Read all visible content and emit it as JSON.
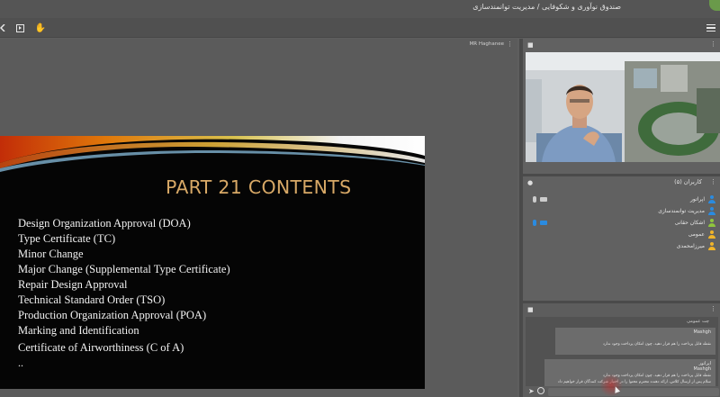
{
  "app": {
    "window_title": "صندوق نوآوری و شکوفایی / مدیریت توانمندسازی",
    "accent_color": "#6a9a4a"
  },
  "toolbar": {
    "icons": [
      "back-arrow-icon",
      "screen-share-icon",
      "hand-icon",
      "menu-icon"
    ],
    "hand_glyph": "✋"
  },
  "presentation": {
    "presenter_name": "MR Haghanee",
    "more_glyph": "⋮",
    "slide": {
      "title": "PART 21 CONTENTS",
      "items": [
        "Design Organization Approval (DOA)",
        "Type Certificate (TC)",
        "Minor Change",
        "Major Change (Supplemental Type Certificate)",
        "Repair Design Approval",
        "Technical Standard Order (TSO)",
        "Production Organization Approval (POA)",
        "Marking and Identification",
        "Certificate of Airworthiness (C of A)"
      ],
      "trailing": "..",
      "title_color": "#d7a866"
    }
  },
  "users": {
    "title": "کاربران (۵)",
    "list": [
      {
        "name": "اپراتور",
        "color": "#2a8be0",
        "mic": true,
        "cam": true,
        "active": false
      },
      {
        "name": "مدیریت توانمندسازی",
        "color": "#2a8be0",
        "mic": false,
        "cam": false,
        "active": false
      },
      {
        "name": "اشکان حقانی",
        "color": "#8fc63e",
        "mic": false,
        "cam": true,
        "active": true
      },
      {
        "name": "عمومی",
        "color": "#f0b429",
        "mic": false,
        "cam": false,
        "active": false
      },
      {
        "name": "میرزامحمدی",
        "color": "#f0b429",
        "mic": false,
        "cam": false,
        "active": false
      }
    ]
  },
  "chat": {
    "from_label": "چت عمومی",
    "messages": [
      {
        "name": "Mashgh",
        "text": "نقطه قابل پرداخت را هم قرار دهید. چون امکان پرداخت وجود ندارد"
      },
      {
        "name": "Mashgh",
        "sender": "اپراتور",
        "text": "نقطه قابل پرداخت را هم قرار دهید. چون امکان پرداخت وجود ندارد",
        "text2": "سلام پس از ارسال کلاس، ارائه دهنده محترم محتوا را در اختیار شرکت کنندگان قرار خواهیم داد"
      }
    ],
    "input_placeholder": "پیام خود را وارد کنید",
    "send_glyph": "➤"
  }
}
